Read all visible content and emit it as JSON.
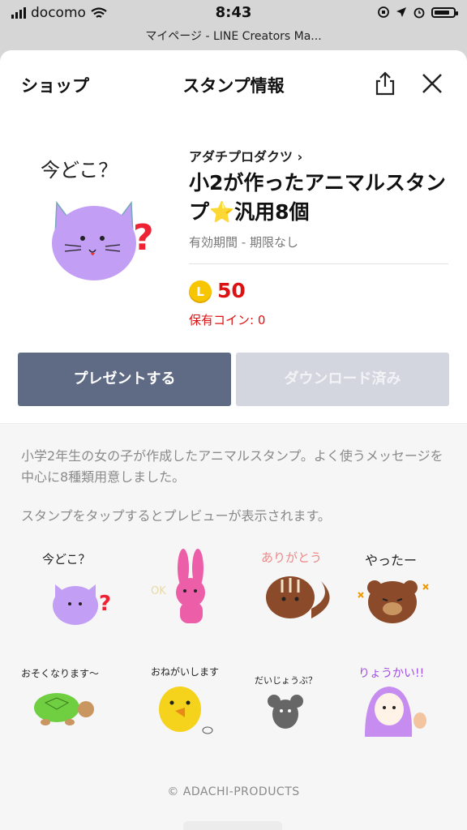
{
  "status_bar": {
    "carrier": "docomo",
    "time": "8:43",
    "battery_level": 0.8
  },
  "browser": {
    "url_title": "マイページ - LINE Creators Ma..."
  },
  "nav": {
    "shop_label": "ショップ",
    "title": "スタンプ情報",
    "share_icon": "share-icon",
    "close_icon": "close-icon"
  },
  "sticker": {
    "main_caption": "今どこ？",
    "creator": "アダチプロダクツ ›",
    "title": "小2が作ったアニマルスタンプ⭐汎用8個",
    "validity": "有効期間 - 期限なし",
    "coin_symbol": "L",
    "price": "50",
    "owned_coins": "保有コイン: 0"
  },
  "buttons": {
    "gift": "プレゼントする",
    "download": "ダウンロード済み"
  },
  "description": "小学2年生の女の子が作成したアニマルスタンプ。よく使うメッセージを中心に8種類用意しました。",
  "preview_hint": "スタンプをタップするとプレビューが表示されます。",
  "stickers": [
    {
      "caption": "今どこ？",
      "animal": "cat"
    },
    {
      "caption": "OK",
      "animal": "rabbit"
    },
    {
      "caption": "ありがとう",
      "animal": "chipmunk"
    },
    {
      "caption": "やったー",
      "animal": "bear"
    },
    {
      "caption": "おそくなります〜",
      "animal": "turtle"
    },
    {
      "caption": "おねがいします",
      "animal": "chick"
    },
    {
      "caption": "だいじょうぶ？",
      "animal": "mouse"
    },
    {
      "caption": "りょうかい!!",
      "animal": "girl"
    }
  ],
  "copyright": "© ADACHI-PRODUCTS",
  "colors": {
    "price_red": "#dd1111",
    "gift_button": "#5f6b84",
    "download_disabled": "#d3d6de",
    "coin_gold": "#f7c600"
  }
}
